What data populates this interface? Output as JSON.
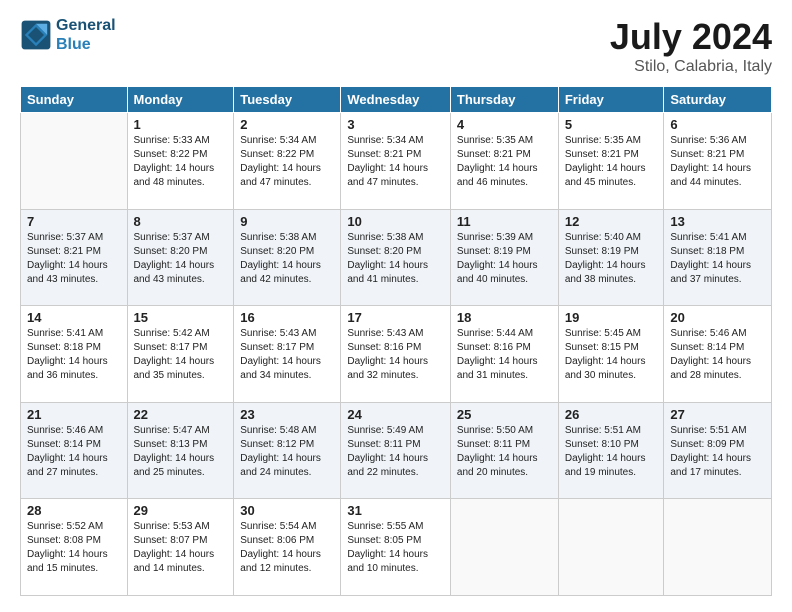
{
  "header": {
    "logo_line1": "General",
    "logo_line2": "Blue",
    "main_title": "July 2024",
    "subtitle": "Stilo, Calabria, Italy"
  },
  "columns": [
    "Sunday",
    "Monday",
    "Tuesday",
    "Wednesday",
    "Thursday",
    "Friday",
    "Saturday"
  ],
  "weeks": [
    [
      {
        "day": "",
        "info": ""
      },
      {
        "day": "1",
        "info": "Sunrise: 5:33 AM\nSunset: 8:22 PM\nDaylight: 14 hours\nand 48 minutes."
      },
      {
        "day": "2",
        "info": "Sunrise: 5:34 AM\nSunset: 8:22 PM\nDaylight: 14 hours\nand 47 minutes."
      },
      {
        "day": "3",
        "info": "Sunrise: 5:34 AM\nSunset: 8:21 PM\nDaylight: 14 hours\nand 47 minutes."
      },
      {
        "day": "4",
        "info": "Sunrise: 5:35 AM\nSunset: 8:21 PM\nDaylight: 14 hours\nand 46 minutes."
      },
      {
        "day": "5",
        "info": "Sunrise: 5:35 AM\nSunset: 8:21 PM\nDaylight: 14 hours\nand 45 minutes."
      },
      {
        "day": "6",
        "info": "Sunrise: 5:36 AM\nSunset: 8:21 PM\nDaylight: 14 hours\nand 44 minutes."
      }
    ],
    [
      {
        "day": "7",
        "info": "Sunrise: 5:37 AM\nSunset: 8:21 PM\nDaylight: 14 hours\nand 43 minutes."
      },
      {
        "day": "8",
        "info": "Sunrise: 5:37 AM\nSunset: 8:20 PM\nDaylight: 14 hours\nand 43 minutes."
      },
      {
        "day": "9",
        "info": "Sunrise: 5:38 AM\nSunset: 8:20 PM\nDaylight: 14 hours\nand 42 minutes."
      },
      {
        "day": "10",
        "info": "Sunrise: 5:38 AM\nSunset: 8:20 PM\nDaylight: 14 hours\nand 41 minutes."
      },
      {
        "day": "11",
        "info": "Sunrise: 5:39 AM\nSunset: 8:19 PM\nDaylight: 14 hours\nand 40 minutes."
      },
      {
        "day": "12",
        "info": "Sunrise: 5:40 AM\nSunset: 8:19 PM\nDaylight: 14 hours\nand 38 minutes."
      },
      {
        "day": "13",
        "info": "Sunrise: 5:41 AM\nSunset: 8:18 PM\nDaylight: 14 hours\nand 37 minutes."
      }
    ],
    [
      {
        "day": "14",
        "info": "Sunrise: 5:41 AM\nSunset: 8:18 PM\nDaylight: 14 hours\nand 36 minutes."
      },
      {
        "day": "15",
        "info": "Sunrise: 5:42 AM\nSunset: 8:17 PM\nDaylight: 14 hours\nand 35 minutes."
      },
      {
        "day": "16",
        "info": "Sunrise: 5:43 AM\nSunset: 8:17 PM\nDaylight: 14 hours\nand 34 minutes."
      },
      {
        "day": "17",
        "info": "Sunrise: 5:43 AM\nSunset: 8:16 PM\nDaylight: 14 hours\nand 32 minutes."
      },
      {
        "day": "18",
        "info": "Sunrise: 5:44 AM\nSunset: 8:16 PM\nDaylight: 14 hours\nand 31 minutes."
      },
      {
        "day": "19",
        "info": "Sunrise: 5:45 AM\nSunset: 8:15 PM\nDaylight: 14 hours\nand 30 minutes."
      },
      {
        "day": "20",
        "info": "Sunrise: 5:46 AM\nSunset: 8:14 PM\nDaylight: 14 hours\nand 28 minutes."
      }
    ],
    [
      {
        "day": "21",
        "info": "Sunrise: 5:46 AM\nSunset: 8:14 PM\nDaylight: 14 hours\nand 27 minutes."
      },
      {
        "day": "22",
        "info": "Sunrise: 5:47 AM\nSunset: 8:13 PM\nDaylight: 14 hours\nand 25 minutes."
      },
      {
        "day": "23",
        "info": "Sunrise: 5:48 AM\nSunset: 8:12 PM\nDaylight: 14 hours\nand 24 minutes."
      },
      {
        "day": "24",
        "info": "Sunrise: 5:49 AM\nSunset: 8:11 PM\nDaylight: 14 hours\nand 22 minutes."
      },
      {
        "day": "25",
        "info": "Sunrise: 5:50 AM\nSunset: 8:11 PM\nDaylight: 14 hours\nand 20 minutes."
      },
      {
        "day": "26",
        "info": "Sunrise: 5:51 AM\nSunset: 8:10 PM\nDaylight: 14 hours\nand 19 minutes."
      },
      {
        "day": "27",
        "info": "Sunrise: 5:51 AM\nSunset: 8:09 PM\nDaylight: 14 hours\nand 17 minutes."
      }
    ],
    [
      {
        "day": "28",
        "info": "Sunrise: 5:52 AM\nSunset: 8:08 PM\nDaylight: 14 hours\nand 15 minutes."
      },
      {
        "day": "29",
        "info": "Sunrise: 5:53 AM\nSunset: 8:07 PM\nDaylight: 14 hours\nand 14 minutes."
      },
      {
        "day": "30",
        "info": "Sunrise: 5:54 AM\nSunset: 8:06 PM\nDaylight: 14 hours\nand 12 minutes."
      },
      {
        "day": "31",
        "info": "Sunrise: 5:55 AM\nSunset: 8:05 PM\nDaylight: 14 hours\nand 10 minutes."
      },
      {
        "day": "",
        "info": ""
      },
      {
        "day": "",
        "info": ""
      },
      {
        "day": "",
        "info": ""
      }
    ]
  ]
}
